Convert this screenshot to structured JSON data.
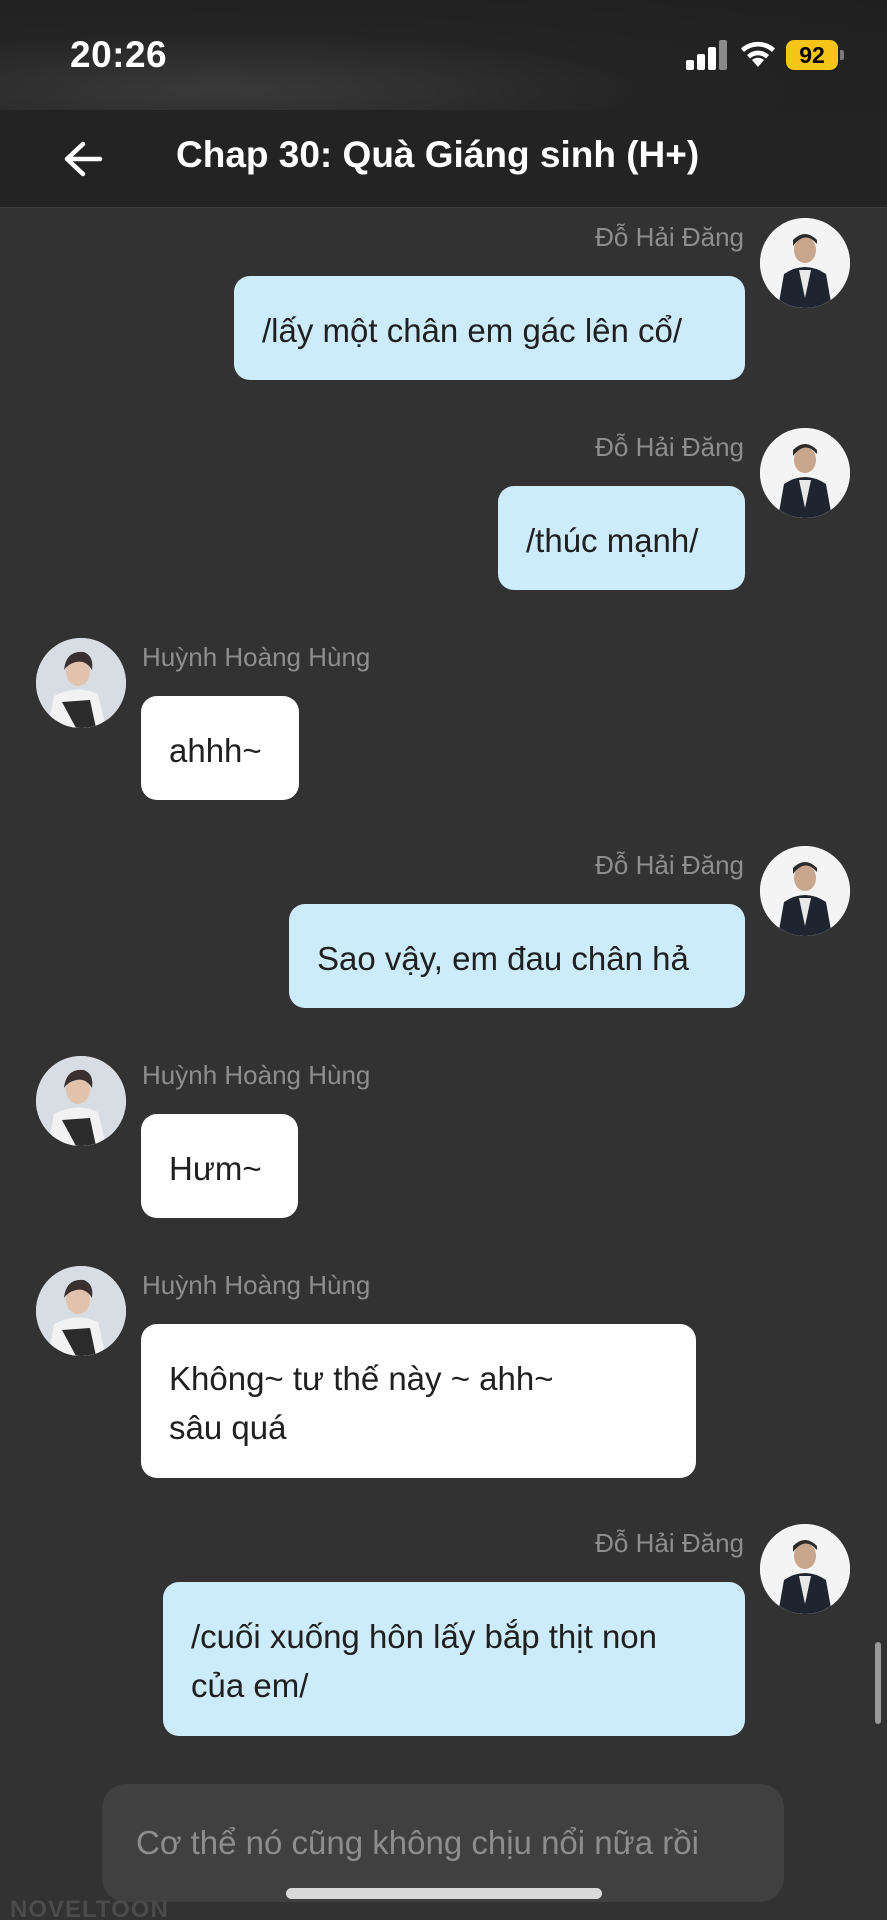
{
  "status_bar": {
    "time": "20:26",
    "battery": "92"
  },
  "header": {
    "title": "Chap 30: Quà Giáng sinh (H+)"
  },
  "messages": [
    {
      "sender": "Đỗ Hải Đăng",
      "side": "right",
      "text": "/lấy một chân em gác lên cổ/"
    },
    {
      "sender": "Đỗ Hải Đăng",
      "side": "right",
      "text": "/thúc mạnh/"
    },
    {
      "sender": "Huỳnh Hoàng Hùng",
      "side": "left",
      "text": "ahhh~"
    },
    {
      "sender": "Đỗ Hải Đăng",
      "side": "right",
      "text": "Sao vậy, em đau chân hả"
    },
    {
      "sender": "Huỳnh Hoàng Hùng",
      "side": "left",
      "text": "Hưm~"
    },
    {
      "sender": "Huỳnh Hoàng Hùng",
      "side": "left",
      "text": "Không~ tư thế này ~ ahh~\nsâu quá"
    },
    {
      "sender": "Đỗ Hải Đăng",
      "side": "right",
      "text": "/cuối xuống hôn lấy bắp thịt non\ncủa em/"
    }
  ],
  "input": {
    "placeholder": "Cơ thể nó cũng không chịu nổi nữa rồi"
  },
  "watermark": "NOVELTOON",
  "colors": {
    "background": "#323232",
    "right_bubble": "#cdecfb",
    "left_bubble": "#ffffff",
    "battery": "#f5c518"
  }
}
